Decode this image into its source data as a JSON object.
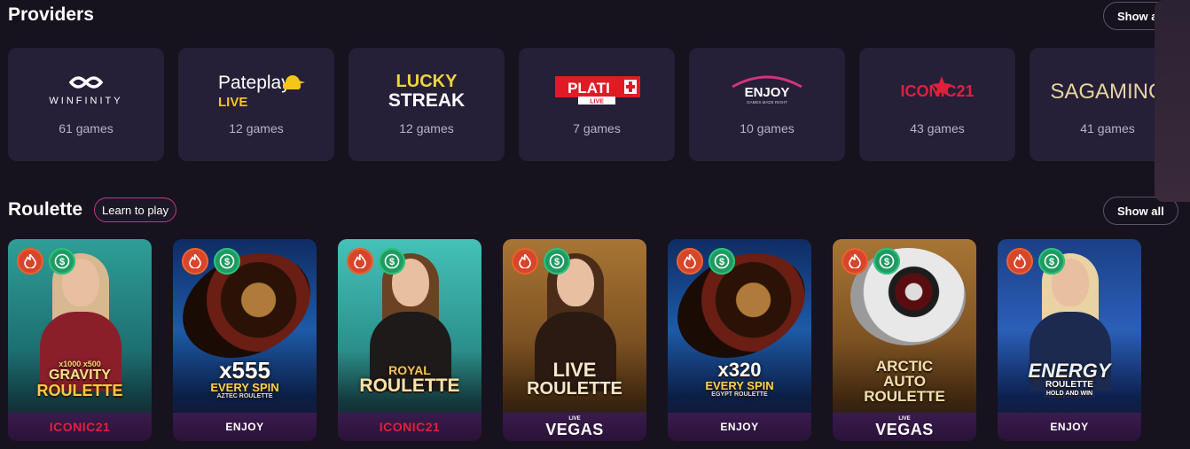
{
  "providers_section": {
    "title": "Providers",
    "show_all_label": "Show all",
    "providers": [
      {
        "name": "WINFINITY",
        "count": "61 games"
      },
      {
        "name": "Pateplay",
        "sub": "LIVE",
        "count": "12 games"
      },
      {
        "name": "LUCKY",
        "sub": "STREAK",
        "count": "12 games"
      },
      {
        "name": "PLATI",
        "sub": "LIVE",
        "count": "7 games"
      },
      {
        "name": "ENJOY",
        "sub": "GAMES MADE RIGHT",
        "count": "10 games"
      },
      {
        "name": "ICONIC21",
        "count": "43 games"
      },
      {
        "name": "SAGAMING",
        "count": "41 games"
      }
    ]
  },
  "roulette_section": {
    "title": "Roulette",
    "learn_label": "Learn to play",
    "show_all_label": "Show all",
    "games": [
      {
        "title_lines": [
          "GRAVITY",
          "ROULETTE"
        ],
        "top_tag": "x1000 x500",
        "footer": "ICONIC21",
        "theme": "teal"
      },
      {
        "title_lines": [
          "x555",
          "EVERY SPIN"
        ],
        "sub": "AZTEC ROULETTE",
        "footer": "ENJOY",
        "theme": "blue"
      },
      {
        "title_lines": [
          "ROYAL",
          "ROULETTE"
        ],
        "footer": "ICONIC21",
        "theme": "teal"
      },
      {
        "title_lines": [
          "LIVE",
          "ROULETTE"
        ],
        "footer": "VEGAS",
        "footer_tag": "LIVE",
        "theme": "brown"
      },
      {
        "title_lines": [
          "x320",
          "EVERY SPIN"
        ],
        "sub": "EGYPT ROULETTE",
        "footer": "ENJOY",
        "theme": "blue"
      },
      {
        "title_lines": [
          "ARCTIC",
          "AUTO",
          "ROULETTE"
        ],
        "footer": "VEGAS",
        "footer_tag": "LIVE",
        "theme": "brown"
      },
      {
        "title_lines": [
          "ENERGY",
          "ROULETTE"
        ],
        "sub": "HOLD AND WIN",
        "footer": "ENJOY",
        "theme": "blue"
      }
    ]
  },
  "colors": {
    "page_bg": "#16121e",
    "card_bg": "#251f38",
    "learn_border": "#c8338f",
    "hot_badge": "#d7452b",
    "cash_badge": "#1f9b62"
  }
}
